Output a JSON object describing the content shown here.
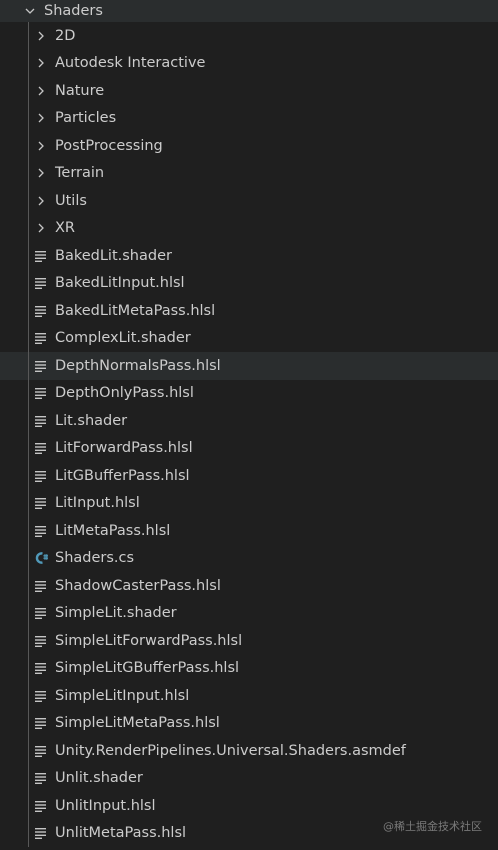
{
  "explorer": {
    "root": {
      "label": "Shaders",
      "expanded": true,
      "icon": "chevron-down-icon"
    },
    "folders": [
      {
        "label": "2D",
        "icon": "chevron-right-icon"
      },
      {
        "label": "Autodesk Interactive",
        "icon": "chevron-right-icon"
      },
      {
        "label": "Nature",
        "icon": "chevron-right-icon"
      },
      {
        "label": "Particles",
        "icon": "chevron-right-icon"
      },
      {
        "label": "PostProcessing",
        "icon": "chevron-right-icon"
      },
      {
        "label": "Terrain",
        "icon": "chevron-right-icon"
      },
      {
        "label": "Utils",
        "icon": "chevron-right-icon"
      },
      {
        "label": "XR",
        "icon": "chevron-right-icon"
      }
    ],
    "files": [
      {
        "label": "BakedLit.shader",
        "icon": "lines-file-icon"
      },
      {
        "label": "BakedLitInput.hlsl",
        "icon": "lines-file-icon"
      },
      {
        "label": "BakedLitMetaPass.hlsl",
        "icon": "lines-file-icon"
      },
      {
        "label": "ComplexLit.shader",
        "icon": "lines-file-icon"
      },
      {
        "label": "DepthNormalsPass.hlsl",
        "icon": "lines-file-icon",
        "hovered": true
      },
      {
        "label": "DepthOnlyPass.hlsl",
        "icon": "lines-file-icon"
      },
      {
        "label": "Lit.shader",
        "icon": "lines-file-icon"
      },
      {
        "label": "LitForwardPass.hlsl",
        "icon": "lines-file-icon"
      },
      {
        "label": "LitGBufferPass.hlsl",
        "icon": "lines-file-icon"
      },
      {
        "label": "LitInput.hlsl",
        "icon": "lines-file-icon"
      },
      {
        "label": "LitMetaPass.hlsl",
        "icon": "lines-file-icon"
      },
      {
        "label": "Shaders.cs",
        "icon": "csharp-file-icon"
      },
      {
        "label": "ShadowCasterPass.hlsl",
        "icon": "lines-file-icon"
      },
      {
        "label": "SimpleLit.shader",
        "icon": "lines-file-icon"
      },
      {
        "label": "SimpleLitForwardPass.hlsl",
        "icon": "lines-file-icon"
      },
      {
        "label": "SimpleLitGBufferPass.hlsl",
        "icon": "lines-file-icon"
      },
      {
        "label": "SimpleLitInput.hlsl",
        "icon": "lines-file-icon"
      },
      {
        "label": "SimpleLitMetaPass.hlsl",
        "icon": "lines-file-icon"
      },
      {
        "label": "Unity.RenderPipelines.Universal.Shaders.asmdef",
        "icon": "lines-file-icon"
      },
      {
        "label": "Unlit.shader",
        "icon": "lines-file-icon"
      },
      {
        "label": "UnlitInput.hlsl",
        "icon": "lines-file-icon"
      },
      {
        "label": "UnlitMetaPass.hlsl",
        "icon": "lines-file-icon"
      }
    ]
  },
  "watermark": {
    "text": "@稀土掘金技术社区"
  },
  "colors": {
    "background": "#1f1f1f",
    "hover": "#2a2d2e",
    "text": "#cccccc",
    "icon": "#c5c5c5",
    "csharp": "#519aba",
    "guide": "#585858"
  }
}
